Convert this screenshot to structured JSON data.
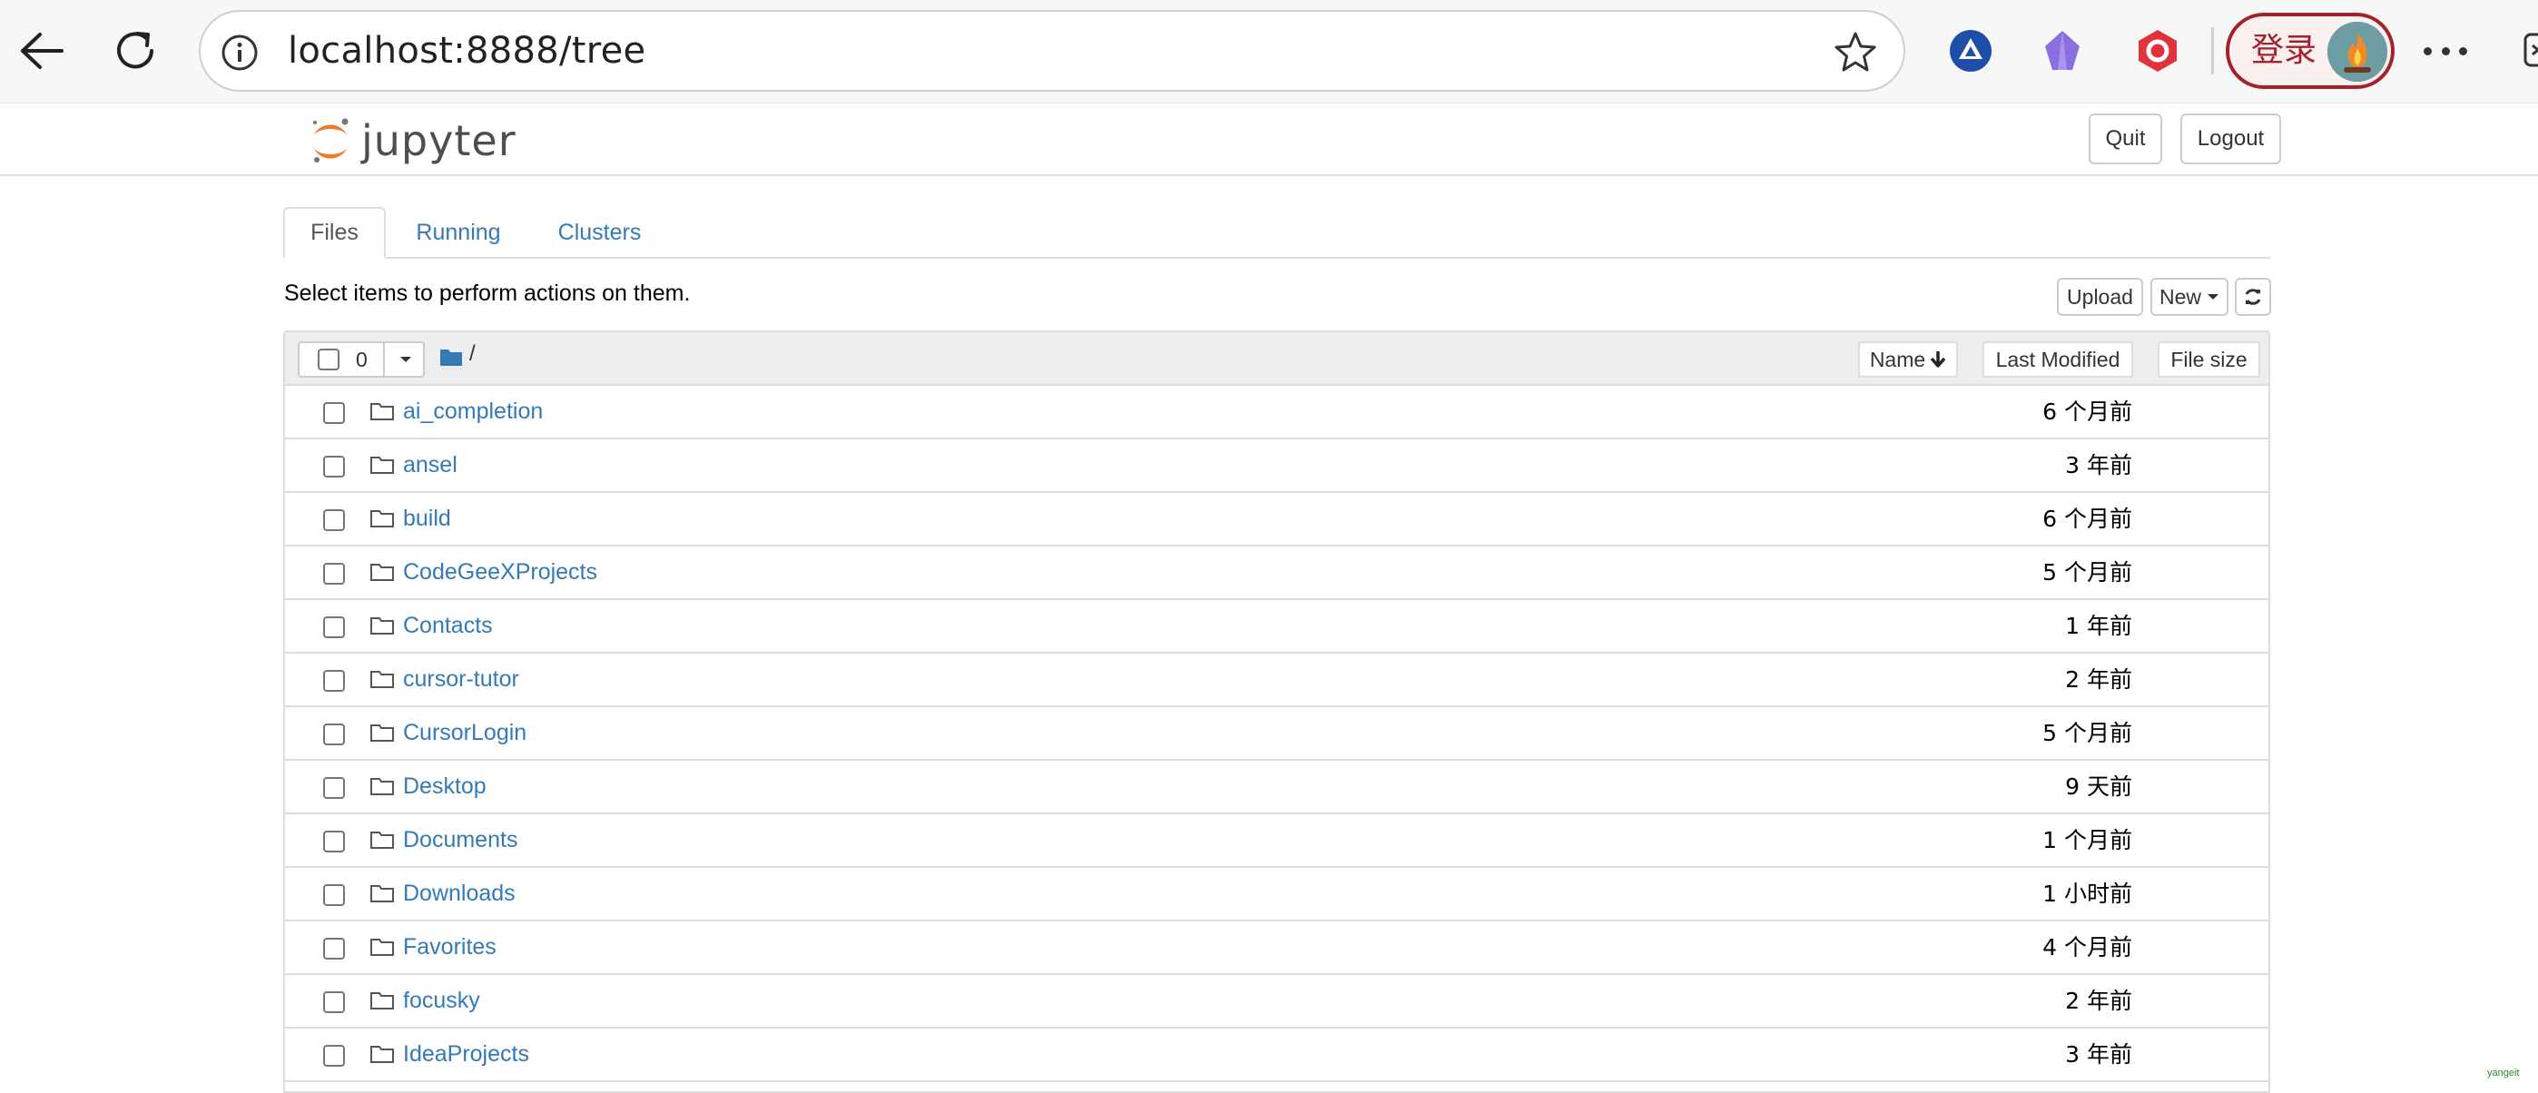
{
  "browser": {
    "url": "localhost:8888/tree",
    "login_label": "登录"
  },
  "header": {
    "logo_text": "jupyter",
    "quit_label": "Quit",
    "logout_label": "Logout"
  },
  "tabs": [
    {
      "label": "Files",
      "active": true
    },
    {
      "label": "Running",
      "active": false
    },
    {
      "label": "Clusters",
      "active": false
    }
  ],
  "toolbar": {
    "hint": "Select items to perform actions on them.",
    "upload_label": "Upload",
    "new_label": "New"
  },
  "list_header": {
    "selected_count": "0",
    "breadcrumb": "/",
    "name_label": "Name",
    "last_modified_label": "Last Modified",
    "file_size_label": "File size"
  },
  "files": [
    {
      "name": "ai_completion",
      "modified": "6 个月前"
    },
    {
      "name": "ansel",
      "modified": "3 年前"
    },
    {
      "name": "build",
      "modified": "6 个月前"
    },
    {
      "name": "CodeGeeXProjects",
      "modified": "5 个月前"
    },
    {
      "name": "Contacts",
      "modified": "1 年前"
    },
    {
      "name": "cursor-tutor",
      "modified": "2 年前"
    },
    {
      "name": "CursorLogin",
      "modified": "5 个月前"
    },
    {
      "name": "Desktop",
      "modified": "9 天前"
    },
    {
      "name": "Documents",
      "modified": "1 个月前"
    },
    {
      "name": "Downloads",
      "modified": "1 小时前"
    },
    {
      "name": "Favorites",
      "modified": "4 个月前"
    },
    {
      "name": "focusky",
      "modified": "2 年前"
    },
    {
      "name": "IdeaProjects",
      "modified": "3 年前"
    }
  ],
  "watermark": "yangeit",
  "colors": {
    "link": "#337ab7",
    "login_accent": "#a4212a",
    "jupyter_orange": "#f37726"
  }
}
